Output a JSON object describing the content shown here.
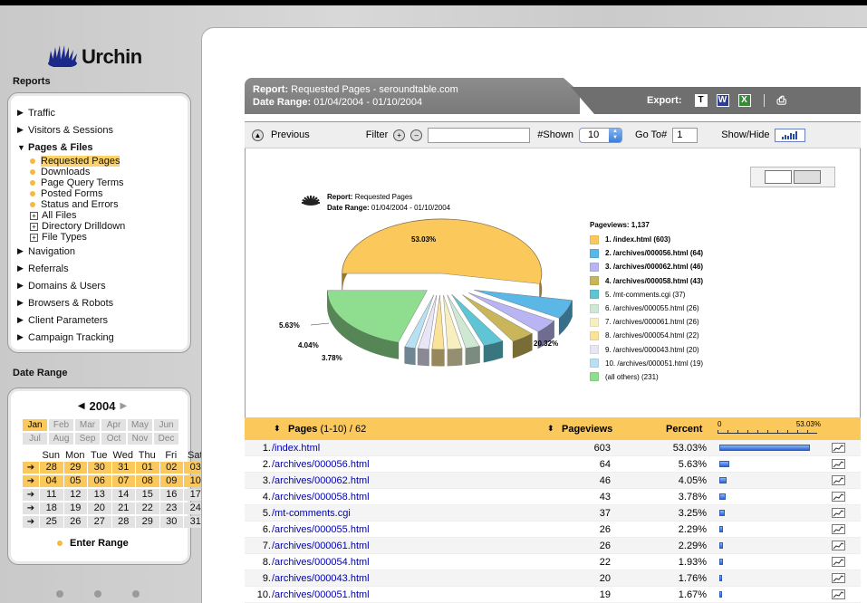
{
  "app": {
    "name": "Urchin"
  },
  "sidebar": {
    "reports_heading": "Reports",
    "nav": [
      {
        "label": "Traffic",
        "expanded": false
      },
      {
        "label": "Visitors & Sessions",
        "expanded": false
      },
      {
        "label": "Pages & Files",
        "expanded": true
      }
    ],
    "sub": [
      {
        "label": "Requested Pages",
        "type": "dot",
        "selected": true
      },
      {
        "label": "Downloads",
        "type": "dot"
      },
      {
        "label": "Page Query Terms",
        "type": "dot"
      },
      {
        "label": "Posted Forms",
        "type": "dot"
      },
      {
        "label": "Status and Errors",
        "type": "dot"
      },
      {
        "label": "All Files",
        "type": "plus"
      },
      {
        "label": "Directory Drilldown",
        "type": "plus"
      },
      {
        "label": "File Types",
        "type": "plus"
      }
    ],
    "nav_after": [
      {
        "label": "Navigation"
      },
      {
        "label": "Referrals"
      },
      {
        "label": "Domains & Users"
      },
      {
        "label": "Browsers & Robots"
      },
      {
        "label": "Client Parameters"
      },
      {
        "label": "Campaign Tracking"
      }
    ],
    "date_heading": "Date Range",
    "calendar": {
      "year": "2004",
      "months": [
        "Jan",
        "Feb",
        "Mar",
        "Apr",
        "May",
        "Jun",
        "Jul",
        "Aug",
        "Sep",
        "Oct",
        "Nov",
        "Dec"
      ],
      "selected_month": "Jan",
      "weekdays": [
        "Sun",
        "Mon",
        "Tue",
        "Wed",
        "Thu",
        "Fri",
        "Sat"
      ],
      "weeks": [
        [
          "28",
          "29",
          "30",
          "31",
          "01",
          "02",
          "03"
        ],
        [
          "04",
          "05",
          "06",
          "07",
          "08",
          "09",
          "10"
        ],
        [
          "11",
          "12",
          "13",
          "14",
          "15",
          "16",
          "17"
        ],
        [
          "18",
          "19",
          "20",
          "21",
          "22",
          "23",
          "24"
        ],
        [
          "25",
          "26",
          "27",
          "28",
          "29",
          "30",
          "31"
        ]
      ],
      "selected_weeks": [
        0,
        1
      ],
      "enter_label": "Enter Range"
    }
  },
  "report": {
    "label": "Report:",
    "name": "Requested Pages - seroundtable.com",
    "range_label": "Date Range:",
    "range": "01/04/2004 - 01/10/2004",
    "export_label": "Export:",
    "export_icons": [
      "T",
      "W",
      "X"
    ]
  },
  "toolbar": {
    "previous": "Previous",
    "filter": "Filter",
    "shown_label": "#Shown",
    "shown_value": "10",
    "goto_label": "Go To#",
    "goto_value": "1",
    "showhide": "Show/Hide"
  },
  "chart_data": {
    "type": "pie",
    "report_label": "Report:",
    "report_name": "Requested Pages",
    "range_label": "Date Range:",
    "range": "01/04/2004 - 01/10/2004",
    "total_label": "Pageviews: 1,137",
    "slices": [
      {
        "label": "1. /index.html (603)",
        "value": 603,
        "color": "#fbc85c",
        "bold": true
      },
      {
        "label": "2. /archives/000056.html (64)",
        "value": 64,
        "color": "#5bb7e6",
        "bold": true
      },
      {
        "label": "3. /archives/000062.html (46)",
        "value": 46,
        "color": "#b9b4f2",
        "bold": true
      },
      {
        "label": "4. /archives/000058.html (43)",
        "value": 43,
        "color": "#c9b55a",
        "bold": true
      },
      {
        "label": "5. /mt-comments.cgi (37)",
        "value": 37,
        "color": "#5fc4d4"
      },
      {
        "label": "6. /archives/000055.html (26)",
        "value": 26,
        "color": "#cfe8d4"
      },
      {
        "label": "7. /archives/000061.html (26)",
        "value": 26,
        "color": "#f7efc0"
      },
      {
        "label": "8. /archives/000054.html (22)",
        "value": 22,
        "color": "#fbe29a"
      },
      {
        "label": "9. /archives/000043.html (20)",
        "value": 20,
        "color": "#e6e6f6"
      },
      {
        "label": "10. /archives/000051.html (19)",
        "value": 19,
        "color": "#b8e0f2"
      },
      {
        "label": "(all others) (231)",
        "value": 231,
        "color": "#8fde8f"
      }
    ],
    "slice_labels": [
      "53.03%",
      "5.63%",
      "4.04%",
      "3.78%",
      "20.32%"
    ]
  },
  "table": {
    "col_pages": "Pages",
    "range": "(1-10)",
    "sep": "/",
    "total": "62",
    "col_pageviews": "Pageviews",
    "col_percent": "Percent",
    "scale_min": "0",
    "scale_max": "53.03%",
    "rows": [
      {
        "n": "1.",
        "page": "/index.html",
        "views": "603",
        "pct": "53.03%",
        "frac": 53.03
      },
      {
        "n": "2.",
        "page": "/archives/000056.html",
        "views": "64",
        "pct": "5.63%",
        "frac": 5.63
      },
      {
        "n": "3.",
        "page": "/archives/000062.html",
        "views": "46",
        "pct": "4.05%",
        "frac": 4.05
      },
      {
        "n": "4.",
        "page": "/archives/000058.html",
        "views": "43",
        "pct": "3.78%",
        "frac": 3.78
      },
      {
        "n": "5.",
        "page": "/mt-comments.cgi",
        "views": "37",
        "pct": "3.25%",
        "frac": 3.25
      },
      {
        "n": "6.",
        "page": "/archives/000055.html",
        "views": "26",
        "pct": "2.29%",
        "frac": 2.29
      },
      {
        "n": "7.",
        "page": "/archives/000061.html",
        "views": "26",
        "pct": "2.29%",
        "frac": 2.29
      },
      {
        "n": "8.",
        "page": "/archives/000054.html",
        "views": "22",
        "pct": "1.93%",
        "frac": 1.93
      },
      {
        "n": "9.",
        "page": "/archives/000043.html",
        "views": "20",
        "pct": "1.76%",
        "frac": 1.76
      },
      {
        "n": "10.",
        "page": "/archives/000051.html",
        "views": "19",
        "pct": "1.67%",
        "frac": 1.67
      }
    ]
  }
}
